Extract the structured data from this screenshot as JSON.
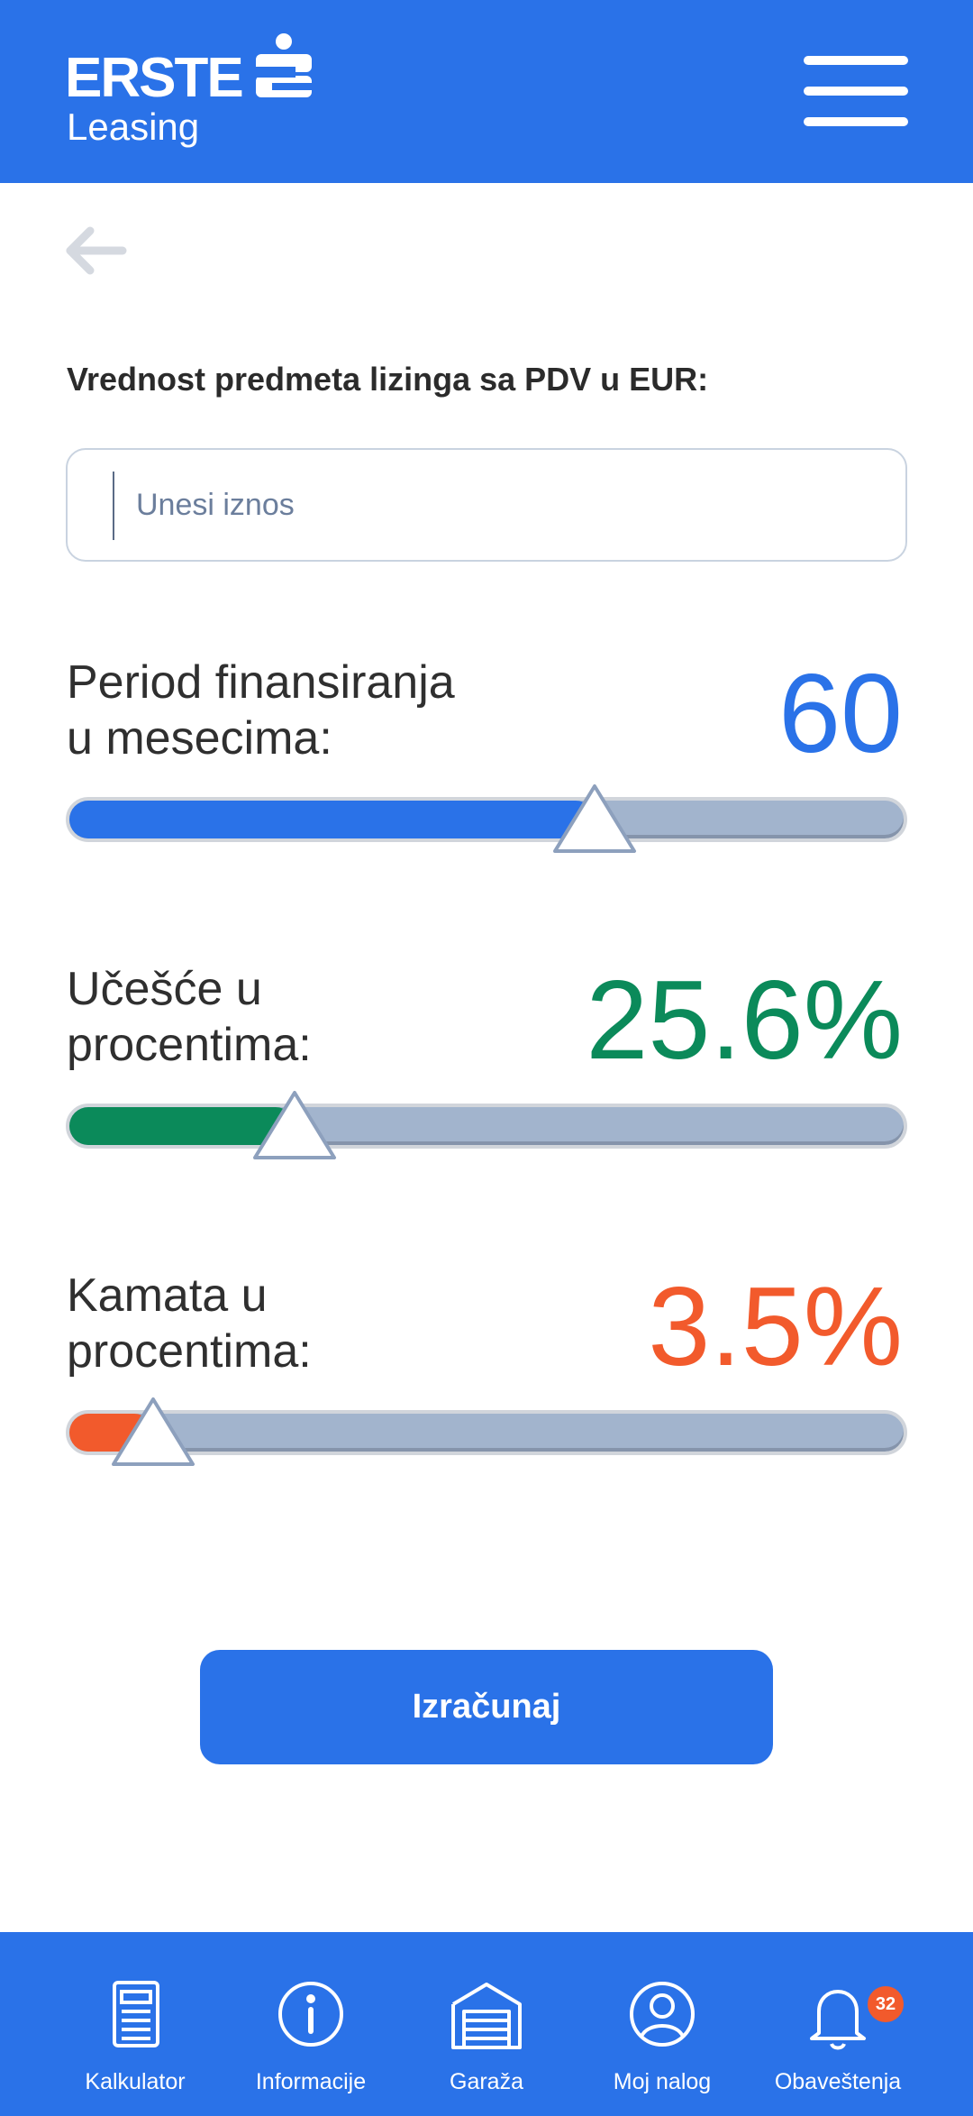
{
  "header": {
    "logo_top": "ERSTE",
    "logo_bottom": "Leasing",
    "logo_icon": "erste-s-icon",
    "menu_icon": "hamburger-icon"
  },
  "back": {
    "icon": "arrow-left-icon"
  },
  "amount": {
    "label": "Vrednost predmeta lizinga sa PDV u EUR:",
    "placeholder": "Unesi iznos",
    "value": ""
  },
  "sliders": [
    {
      "label_line1": "Period finansiranja",
      "label_line2": "u mesecima:",
      "value": "60",
      "fraction": 0.63,
      "color": "#2A72E8"
    },
    {
      "label_line1": "Učešće u",
      "label_line2": "procentima:",
      "value": "25.6%",
      "fraction": 0.27,
      "color": "#0B8A5A"
    },
    {
      "label_line1": "Kamata u",
      "label_line2": "procentima:",
      "value": "3.5%",
      "fraction": 0.1,
      "color": "#F25A2C"
    }
  ],
  "calculate": {
    "label": "Izračunaj"
  },
  "nav": {
    "items": [
      {
        "label": "Kalkulator",
        "icon": "calculator-icon"
      },
      {
        "label": "Informacije",
        "icon": "info-icon"
      },
      {
        "label": "Garaža",
        "icon": "garage-icon"
      },
      {
        "label": "Moj nalog",
        "icon": "user-icon"
      },
      {
        "label": "Obaveštenja",
        "icon": "bell-icon",
        "badge": "32"
      }
    ]
  },
  "colors": {
    "primary": "#2A72E8",
    "green": "#0B8A5A",
    "orange": "#F25A2C",
    "track": "#A2B4CD"
  }
}
